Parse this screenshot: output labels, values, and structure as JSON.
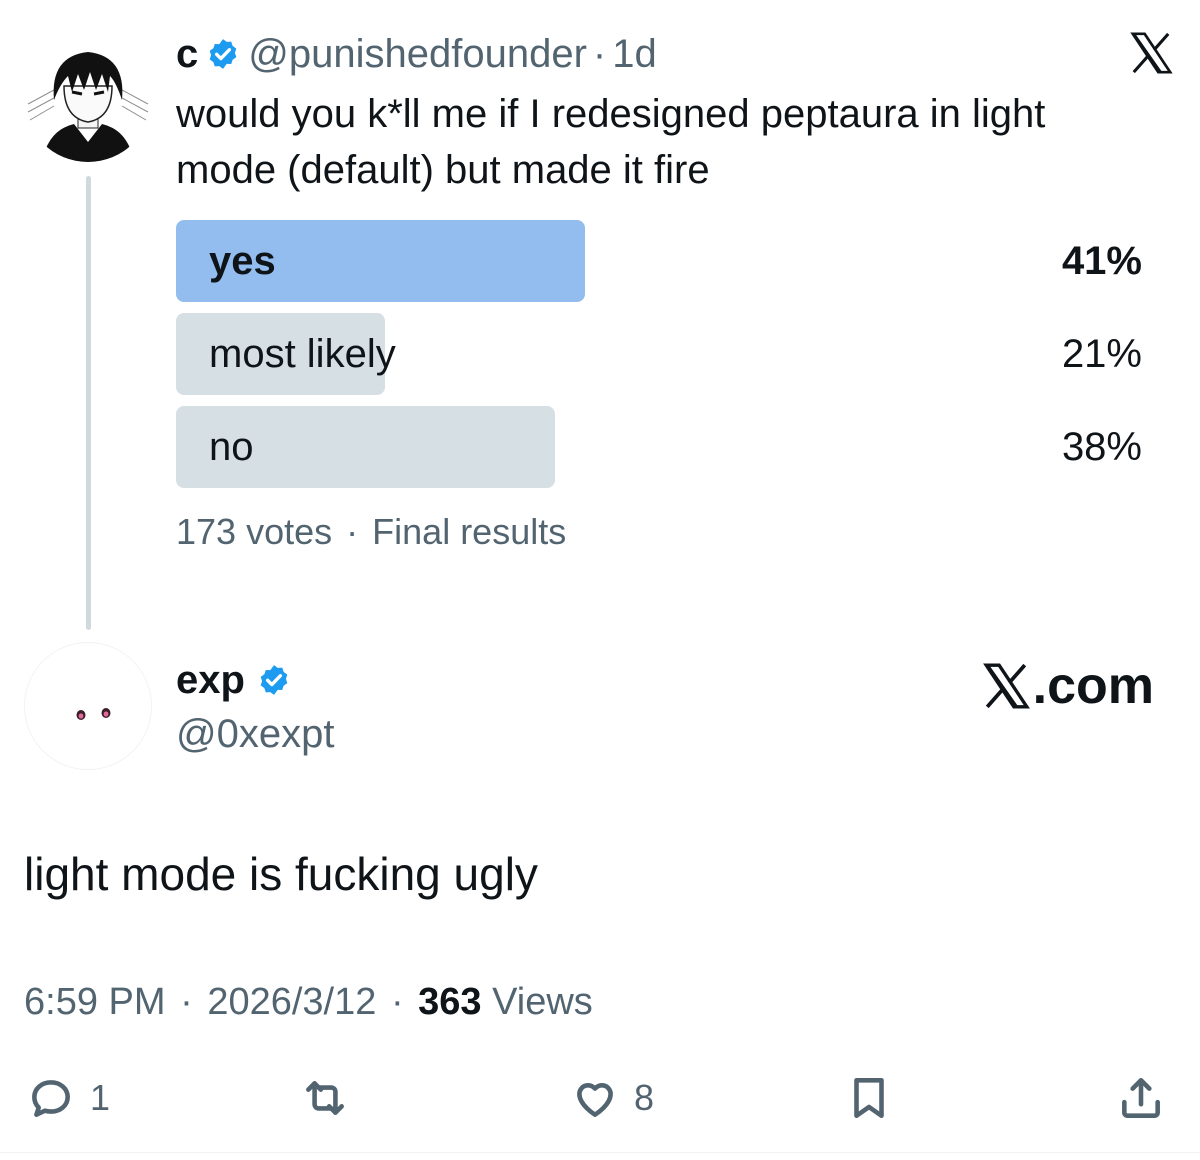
{
  "parent_tweet": {
    "display_name": "c",
    "handle": "@punishedfounder",
    "separator": "·",
    "time_ago": "1d",
    "text": "would you k*ll me if I redesigned peptaura in light mode (default) but made it fire",
    "poll": {
      "options": [
        {
          "label": "yes",
          "percent": "41%",
          "fraction": 0.41,
          "winner": true
        },
        {
          "label": "most likely",
          "percent": "21%",
          "fraction": 0.21,
          "winner": false
        },
        {
          "label": "no",
          "percent": "38%",
          "fraction": 0.38,
          "winner": false
        }
      ],
      "votes": "173 votes",
      "separator": "·",
      "status": "Final results"
    }
  },
  "main_tweet": {
    "display_name": "exp",
    "handle": "@0xexpt",
    "brand": ".com",
    "text": "light mode is fucking ugly",
    "time": "6:59 PM",
    "date": "2026/3/12",
    "views_count": "363",
    "views_label": "Views",
    "sep": "·"
  },
  "actions": {
    "reply_icon": "reply-icon",
    "reply_count": "1",
    "retweet_icon": "retweet-icon",
    "like_icon": "heart-icon",
    "like_count": "8",
    "bookmark_icon": "bookmark-icon",
    "share_icon": "share-icon"
  },
  "colors": {
    "verified": "#1d9bf0",
    "poll_winner": "#93bdee",
    "poll_other": "#cfd9de",
    "secondary_text": "#536471",
    "primary_text": "#0f1419"
  }
}
